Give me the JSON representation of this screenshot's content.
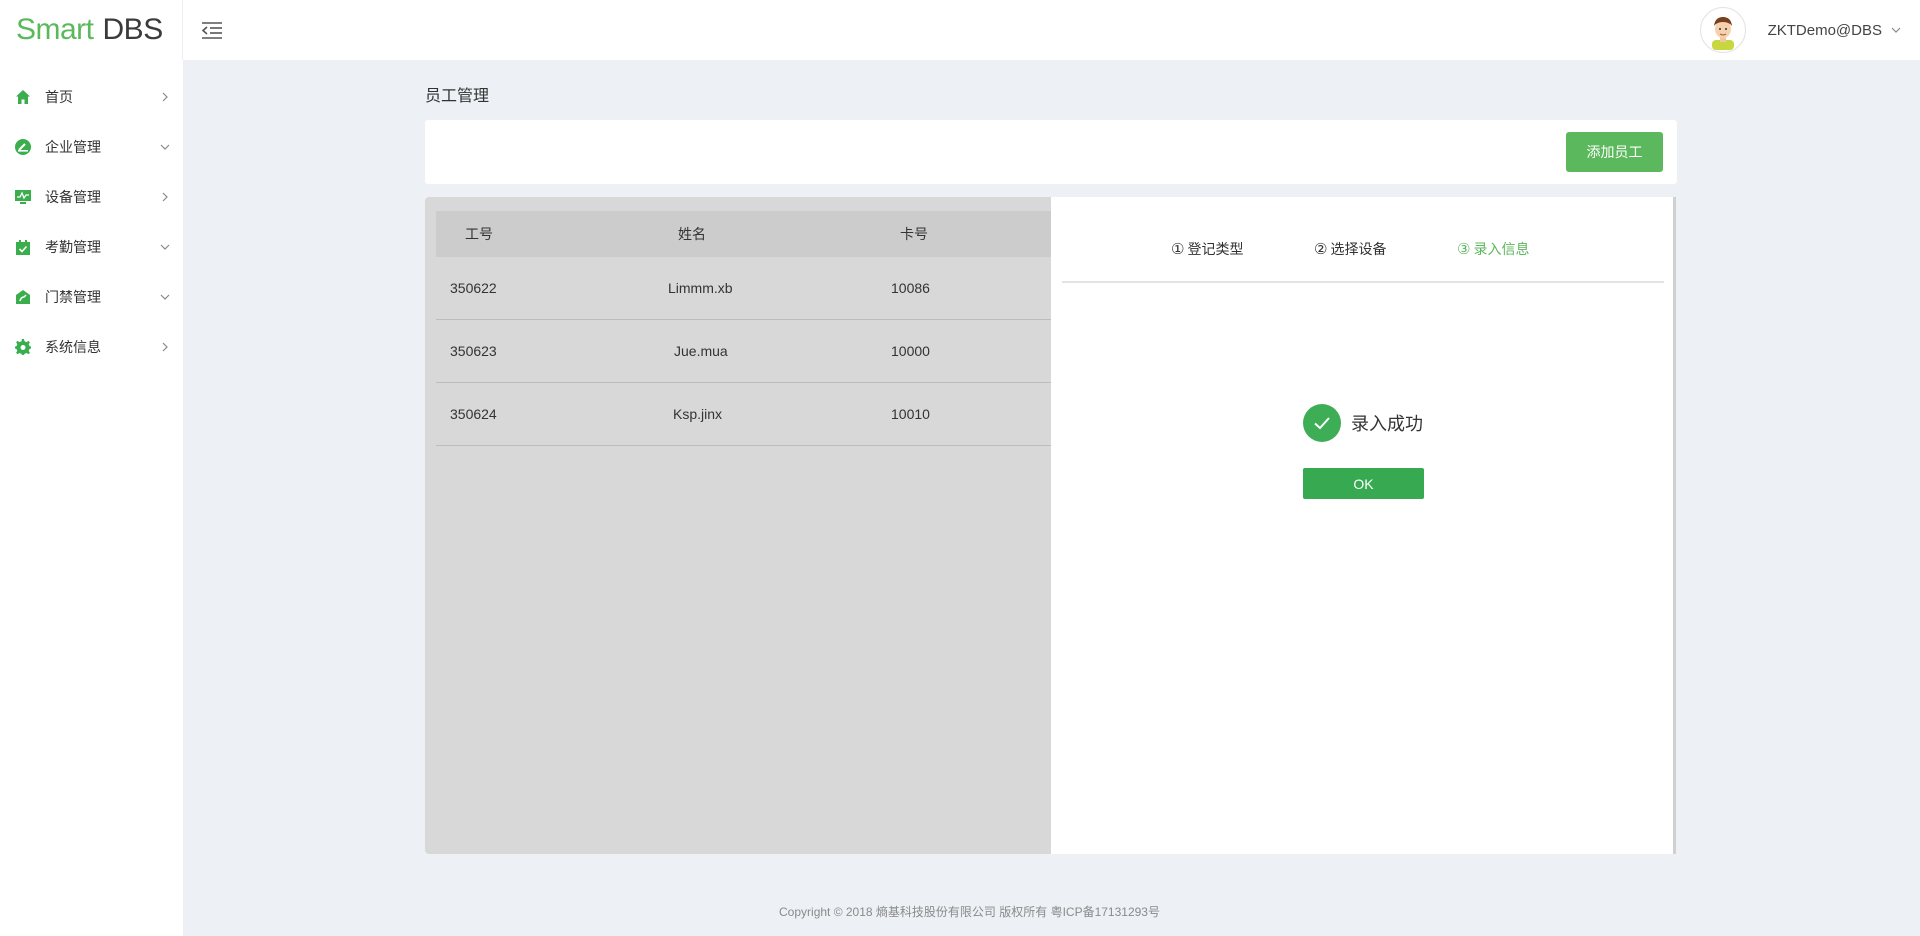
{
  "app": {
    "logo_part1": "Smart",
    "logo_part2": "DBS",
    "user_name": "ZKTDemo@DBS"
  },
  "sidebar": {
    "items": [
      {
        "label": "首页",
        "icon": "home-icon",
        "caret": "right"
      },
      {
        "label": "企业管理",
        "icon": "enterprise-icon",
        "caret": "down"
      },
      {
        "label": "设备管理",
        "icon": "device-monitor-icon",
        "caret": "right"
      },
      {
        "label": "考勤管理",
        "icon": "attendance-calendar-icon",
        "caret": "down"
      },
      {
        "label": "门禁管理",
        "icon": "access-control-icon",
        "caret": "down"
      },
      {
        "label": "系统信息",
        "icon": "gear-icon",
        "caret": "right"
      }
    ]
  },
  "page": {
    "title": "员工管理",
    "add_button": "添加员工"
  },
  "table": {
    "columns": [
      "工号",
      "姓名",
      "卡号"
    ],
    "rows": [
      [
        "350622",
        "Limmm.xb",
        "10086"
      ],
      [
        "350623",
        "Jue.mua",
        "10000"
      ],
      [
        "350624",
        "Ksp.jinx",
        "10010"
      ]
    ]
  },
  "dialog": {
    "steps": [
      {
        "num": "①",
        "label": "登记类型",
        "active": false
      },
      {
        "num": "②",
        "label": "选择设备",
        "active": false
      },
      {
        "num": "③",
        "label": "录入信息",
        "active": true
      }
    ],
    "success_text": "录入成功",
    "ok_label": "OK"
  },
  "footer": {
    "copyright": "Copyright © 2018 熵基科技股份有限公司 版权所有 粤ICP备17131293号"
  },
  "colors": {
    "brand_green": "#5cb85c",
    "success_green": "#36a951",
    "background": "#edf0f5",
    "overlay_gray": "#d8d8d8"
  }
}
